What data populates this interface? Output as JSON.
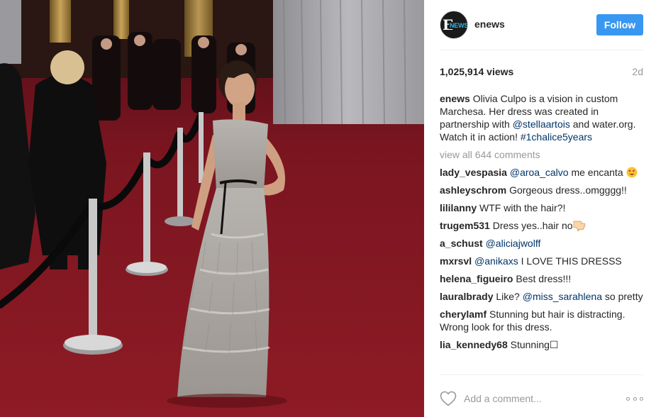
{
  "post": {
    "username": "enews",
    "follow_label": "Follow",
    "avatar_logo_letter": "E",
    "avatar_logo_word": "NEWS",
    "views": "1,025,914 views",
    "time_ago": "2d",
    "caption": {
      "username": "enews",
      "text_1": "Olivia Culpo is a vision in custom Marchesa. Her dress was created in partnership with ",
      "mention": "@stellaartois",
      "text_2": " and water.org. Watch it in action! ",
      "hashtag": "#1chalice5years"
    },
    "view_all_comments": "view all 644 comments",
    "comments": [
      {
        "username": "lady_vespasia",
        "mention": "@aroa_calvo",
        "text": " me encanta ",
        "emoji": "heart-eyes"
      },
      {
        "username": "ashleyschrom",
        "text": "Gorgeous dress..omgggg!!"
      },
      {
        "username": "lililanny",
        "text": "WTF with the hair?!"
      },
      {
        "username": "trugem531",
        "text": "Dress yes..hair no",
        "emoji": "thumbs-down"
      },
      {
        "username": "a_schust",
        "mention": "@aliciajwolff"
      },
      {
        "username": "mxrsvl",
        "mention": "@anikaxs",
        "text": " I LOVE THIS DRESSS"
      },
      {
        "username": "helena_figueiro",
        "text": "Best dress!!!"
      },
      {
        "username": "lauralbrady",
        "text": "Like? ",
        "mention": "@miss_sarahlena",
        "text_after": " so pretty"
      },
      {
        "username": "cherylamf",
        "text": "Stunning but hair is distracting. Wrong look for this dress."
      },
      {
        "username": "lia_kennedy68",
        "text": "Stunning☐"
      }
    ],
    "add_comment_placeholder": "Add a comment...",
    "icons": {
      "like": "heart-outline-icon",
      "more": "more-options-icon",
      "heart_eyes": "heart-eyes-emoji",
      "thumbs_down": "thumbs-down-emoji"
    },
    "colors": {
      "follow": "#3897f0",
      "link": "#003569",
      "muted": "#999999",
      "text": "#262626"
    }
  }
}
